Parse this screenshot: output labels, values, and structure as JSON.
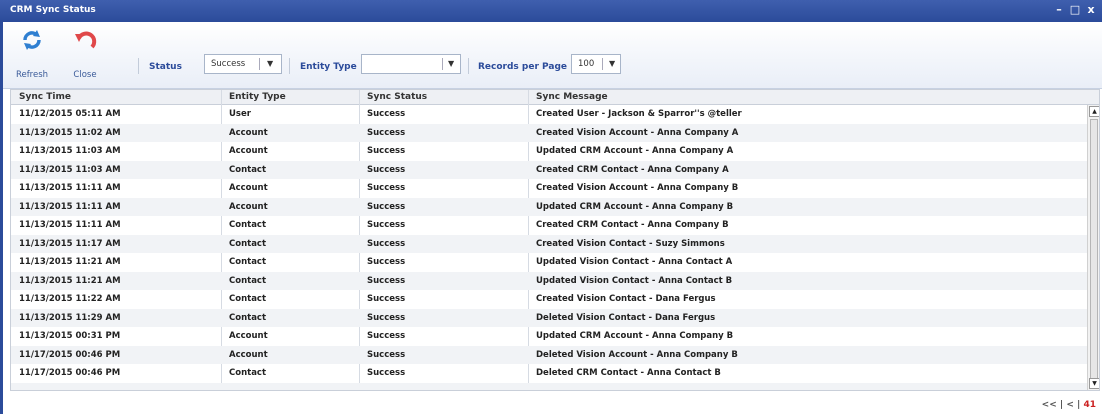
{
  "window": {
    "title": "CRM Sync Status",
    "controls": {
      "minimize": "–",
      "maximize": "□",
      "close": "x"
    }
  },
  "toolbar": {
    "refresh_label": "Refresh",
    "close_label": "Close",
    "status_label": "Status",
    "status_value": "Success",
    "entity_type_label": "Entity Type",
    "entity_type_value": "",
    "records_per_page_label": "Records per Page",
    "records_per_page_value": "100"
  },
  "grid": {
    "columns": [
      "Sync Time",
      "Entity Type",
      "Sync Status",
      "Sync Message"
    ],
    "rows": [
      [
        "11/12/2015 05:11 AM",
        "User",
        "Success",
        "Created User - Jackson & Sparror''s @teller"
      ],
      [
        "11/13/2015 11:02 AM",
        "Account",
        "Success",
        "Created Vision Account - Anna Company A"
      ],
      [
        "11/13/2015 11:03 AM",
        "Account",
        "Success",
        "Updated CRM Account - Anna Company A"
      ],
      [
        "11/13/2015 11:03 AM",
        "Contact",
        "Success",
        "Created CRM Contact -  Anna Company A"
      ],
      [
        "11/13/2015 11:11 AM",
        "Account",
        "Success",
        "Created Vision Account - Anna Company B"
      ],
      [
        "11/13/2015 11:11 AM",
        "Account",
        "Success",
        "Updated CRM Account - Anna Company B"
      ],
      [
        "11/13/2015 11:11 AM",
        "Contact",
        "Success",
        "Created CRM Contact -  Anna Company B"
      ],
      [
        "11/13/2015 11:17 AM",
        "Contact",
        "Success",
        "Created Vision Contact - Suzy Simmons"
      ],
      [
        "11/13/2015 11:21 AM",
        "Contact",
        "Success",
        "Updated Vision Contact -  Anna Contact A"
      ],
      [
        "11/13/2015 11:21 AM",
        "Contact",
        "Success",
        "Updated Vision Contact -  Anna Contact B"
      ],
      [
        "11/13/2015 11:22 AM",
        "Contact",
        "Success",
        "Created Vision Contact - Dana Fergus"
      ],
      [
        "11/13/2015 11:29 AM",
        "Contact",
        "Success",
        "Deleted Vision Contact - Dana Fergus"
      ],
      [
        "11/13/2015 00:31 PM",
        "Account",
        "Success",
        "Updated CRM Account - Anna Company B"
      ],
      [
        "11/17/2015 00:46 PM",
        "Account",
        "Success",
        "Deleted Vision Account - Anna Company B"
      ],
      [
        "11/17/2015 00:46 PM",
        "Contact",
        "Success",
        "Deleted CRM Contact -  Anna Contact B"
      ],
      [
        "",
        "",
        "",
        ""
      ]
    ]
  },
  "pager": {
    "first": "<<",
    "prev": "<",
    "separator": "|",
    "current": "41"
  },
  "colors": {
    "titlebar": "#2b4b9a",
    "accent": "#2b4b9a",
    "pager_current": "#cc2222"
  },
  "icons": {
    "refresh": "refresh-icon",
    "close": "close-icon"
  }
}
